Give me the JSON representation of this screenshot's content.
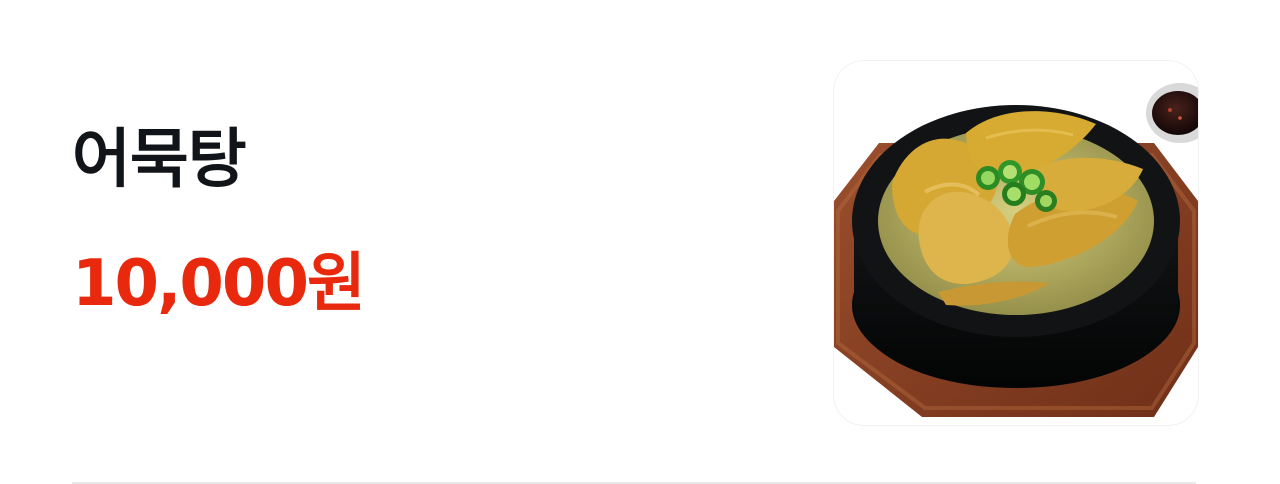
{
  "menu_item": {
    "name": "어묵탕",
    "price": "10,000원"
  },
  "colors": {
    "name_text": "#111418",
    "price_text": "#e8290d",
    "divider": "#e9e9e9"
  }
}
